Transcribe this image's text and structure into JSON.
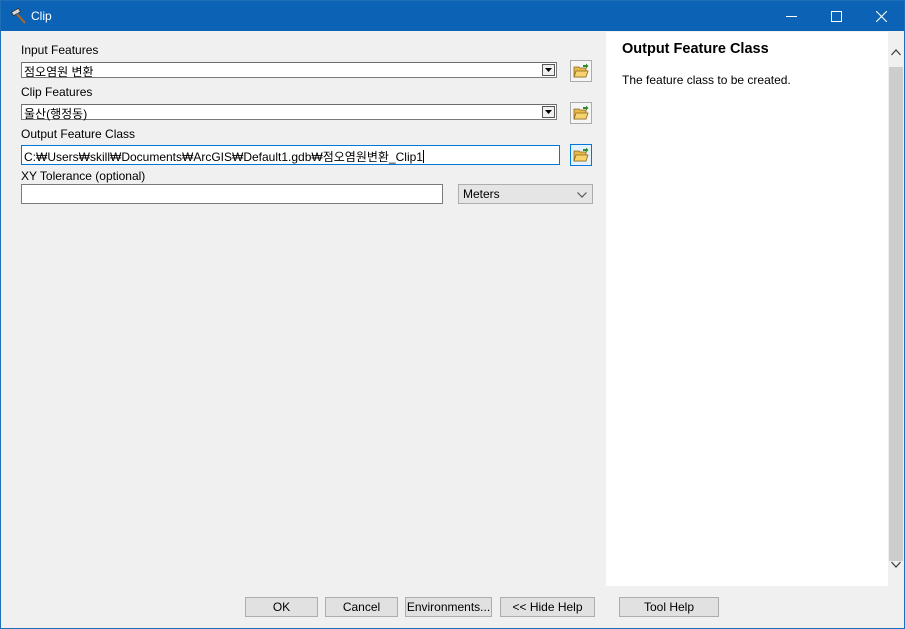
{
  "window": {
    "title": "Clip",
    "titlebar_color": "#0c63b5"
  },
  "form": {
    "input_features": {
      "label": "Input Features",
      "value": "점오염원 변환"
    },
    "clip_features": {
      "label": "Clip Features",
      "value": "울산(행정동)"
    },
    "output_feature_class": {
      "label": "Output Feature Class",
      "value": "C:₩Users₩skill₩Documents₩ArcGIS₩Default1.gdb₩점오염원변환_Clip1"
    },
    "xy_tolerance": {
      "label": "XY Tolerance (optional)",
      "value": "",
      "units": "Meters"
    }
  },
  "help": {
    "title": "Output Feature Class",
    "text": "The feature class to be created."
  },
  "buttons": {
    "ok": "OK",
    "cancel": "Cancel",
    "environments": "Environments...",
    "hide_help": "<< Hide Help",
    "tool_help": "Tool Help"
  },
  "icons": {
    "title": "hammer-icon",
    "browse": "folder-open-icon",
    "dropdown": "chevron-down-icon"
  }
}
